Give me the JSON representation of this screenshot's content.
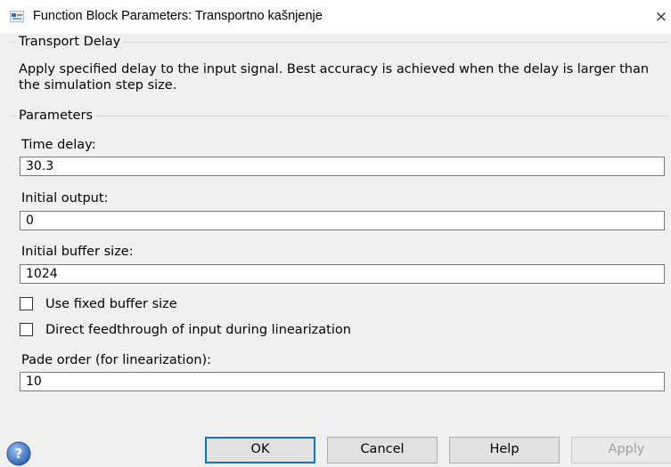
{
  "window": {
    "title": "Function Block Parameters: Transportno kašnjenje",
    "close_glyph": "×",
    "icon": "simulink-block-icon"
  },
  "block": {
    "group_label": "Transport Delay",
    "description": "Apply specified delay to the input signal.  Best accuracy is achieved when the delay is larger than the simulation step size."
  },
  "parameters": {
    "group_label": "Parameters",
    "time_delay": {
      "label": "Time delay:",
      "value": "30.3"
    },
    "initial_output": {
      "label": "Initial output:",
      "value": "0"
    },
    "initial_buffer_size": {
      "label": "Initial buffer size:",
      "value": "1024"
    },
    "use_fixed_buffer": {
      "label": "Use fixed buffer size",
      "checked": false
    },
    "direct_feedthrough": {
      "label": "Direct feedthrough of input during linearization",
      "checked": false
    },
    "pade_order": {
      "label": "Pade order (for linearization):",
      "value": "10"
    }
  },
  "buttons": {
    "ok": "OK",
    "cancel": "Cancel",
    "help": "Help",
    "apply": "Apply",
    "help_icon": "help-question-icon"
  },
  "colors": {
    "default_button_border": "#0078d7",
    "help_icon": "#3b6fc4"
  }
}
